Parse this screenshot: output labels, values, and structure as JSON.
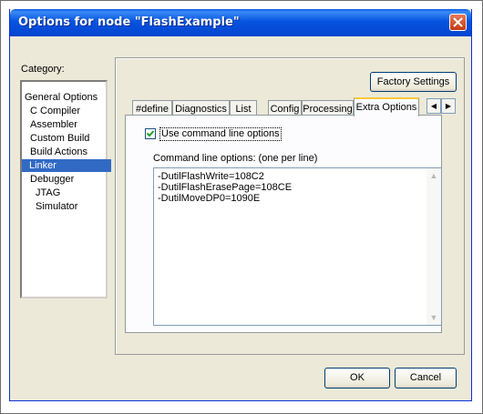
{
  "window": {
    "title": "Options for node \"FlashExample\""
  },
  "category": {
    "label": "Category:",
    "items": [
      "General Options",
      "C Compiler",
      "Assembler",
      "Custom Build",
      "Build Actions",
      "Linker",
      "Debugger",
      "JTAG",
      "Simulator"
    ],
    "selected": "Linker"
  },
  "factory_settings_label": "Factory Settings",
  "tabs": [
    "#define",
    "Diagnostics",
    "List",
    "Config",
    "Processing",
    "Extra Options"
  ],
  "active_tab": "Extra Options",
  "extra_options": {
    "use_command_line_label": "Use command line options",
    "use_command_line_checked": true,
    "caption": "Command line options:  (one per line)",
    "lines": [
      "-DutilFlashWrite=108C2",
      "-DutilFlashErasePage=108CE",
      "-DutilMoveDP0=1090E"
    ]
  },
  "buttons": {
    "ok": "OK",
    "cancel": "Cancel"
  },
  "colors": {
    "title_bar": "#0653e0",
    "selection": "#316ac5",
    "tab_highlight": "#ffc83c"
  }
}
